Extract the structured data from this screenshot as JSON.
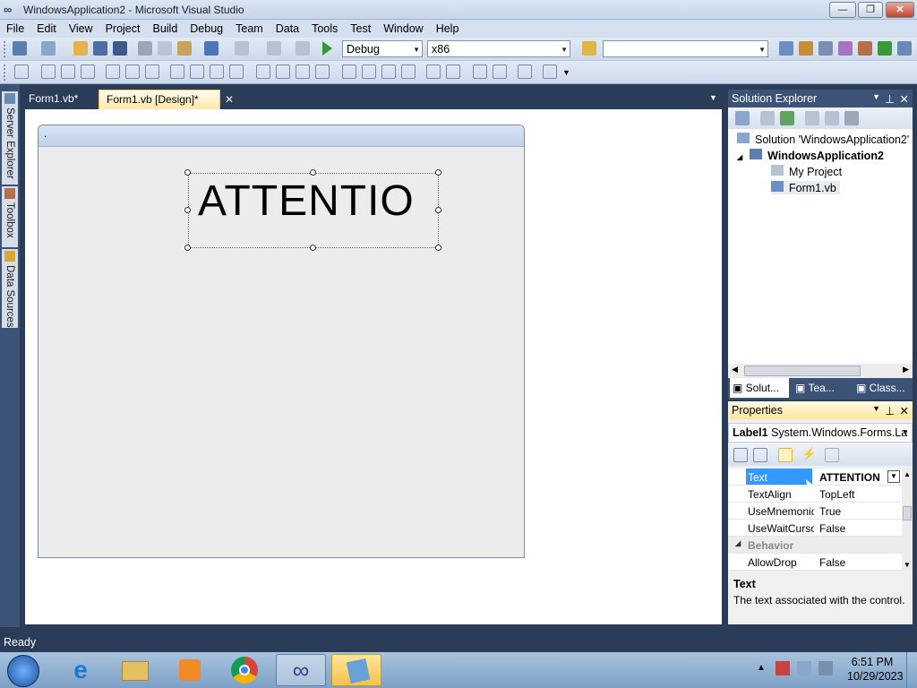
{
  "window": {
    "title": "WindowsApplication2 - Microsoft Visual Studio"
  },
  "menu": [
    "File",
    "Edit",
    "View",
    "Project",
    "Build",
    "Debug",
    "Team",
    "Data",
    "Tools",
    "Test",
    "Window",
    "Help"
  ],
  "toolbar": {
    "config": "Debug",
    "platform": "x86",
    "find_value": ""
  },
  "side_tabs": [
    "Server Explorer",
    "Toolbox",
    "Data Sources"
  ],
  "doc_tabs": [
    {
      "label": "Form1.vb*"
    },
    {
      "label": "Form1.vb [Design]*"
    }
  ],
  "form": {
    "caption": ".",
    "label_text": "ATTENTIO"
  },
  "solution_explorer": {
    "title": "Solution Explorer",
    "items": [
      {
        "label": "Solution 'WindowsApplication2'"
      },
      {
        "label": "WindowsApplication2"
      },
      {
        "label": "My Project"
      },
      {
        "label": "Form1.vb"
      }
    ],
    "tabs": [
      "Solut...",
      "Tea...",
      "Class..."
    ]
  },
  "properties": {
    "title": "Properties",
    "object_name": "Label1",
    "object_type": "System.Windows.Forms.La",
    "rows": [
      {
        "name": "Text",
        "value": "ATTENTION"
      },
      {
        "name": "TextAlign",
        "value": "TopLeft"
      },
      {
        "name": "UseMnemonic",
        "value": "True"
      },
      {
        "name": "UseWaitCursor",
        "value": "False"
      },
      {
        "name": "Behavior",
        "value": ""
      },
      {
        "name": "AllowDrop",
        "value": "False"
      }
    ],
    "desc_title": "Text",
    "desc_text": "The text associated with the control."
  },
  "status": "Ready",
  "clock": {
    "time": "6:51 PM",
    "date": "10/29/2023"
  }
}
